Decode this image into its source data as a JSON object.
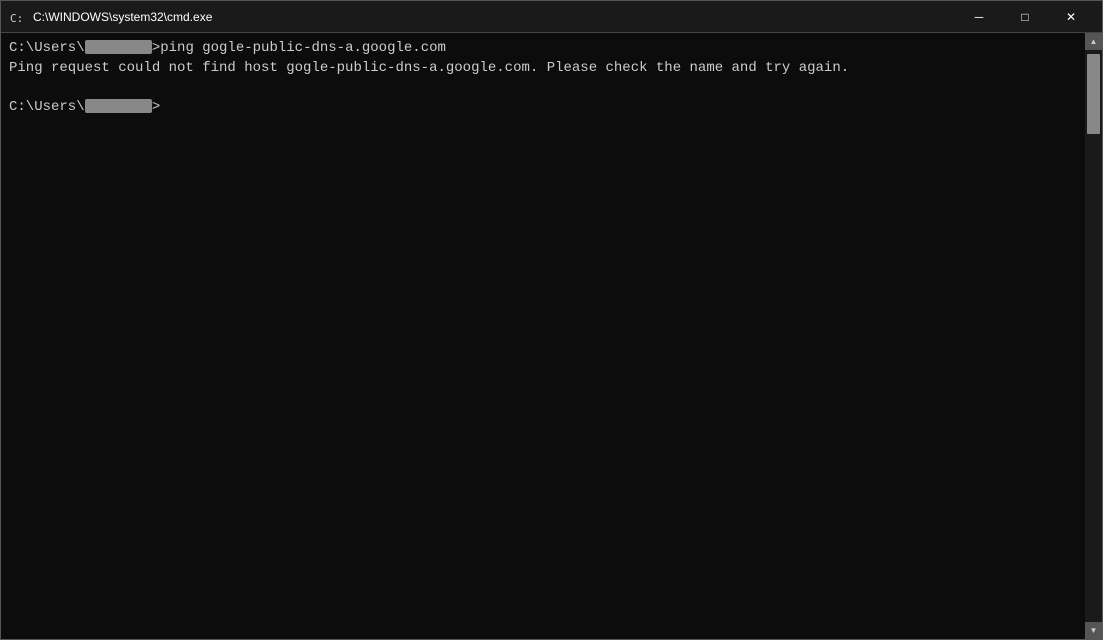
{
  "titlebar": {
    "title": "C:\\WINDOWS\\system32\\cmd.exe",
    "minimize_label": "─",
    "maximize_label": "□",
    "close_label": "✕"
  },
  "terminal": {
    "line1_prefix": "C:\\Users\\",
    "line1_user": "████████",
    "line1_command": ">ping gogle-public-dns-a.google.com",
    "line2": "Ping request could not find host gogle-public-dns-a.google.com. Please check the name and try again.",
    "line3": "",
    "line4_prefix": "C:\\Users\\",
    "line4_user": "████████",
    "line4_prompt": ">"
  }
}
